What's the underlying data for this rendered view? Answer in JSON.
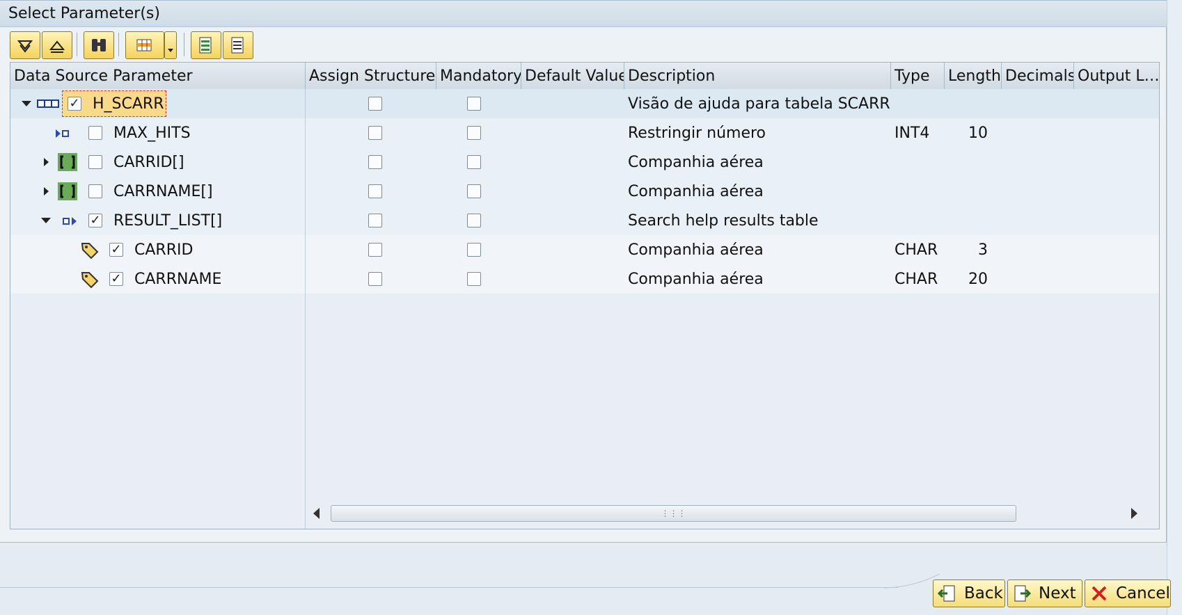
{
  "window": {
    "title": "Select Parameter(s)"
  },
  "toolbar": {
    "buttons": [
      "expand-all-icon",
      "collapse-all-icon",
      "find-icon",
      "layout-icon",
      "select-all-icon",
      "deselect-all-icon"
    ]
  },
  "grid": {
    "columns": [
      "Data Source Parameter",
      "Assign Structure",
      "Mandatory",
      "Default Value",
      "Description",
      "Type",
      "Length",
      "Decimals",
      "Output L…"
    ],
    "rows": [
      {
        "name": "H_SCARR",
        "checked": true,
        "description": "Visão de ajuda para tabela SCARR",
        "type": "",
        "length": ""
      },
      {
        "name": "MAX_HITS",
        "checked": false,
        "description": "Restringir número",
        "type": "INT4",
        "length": "10"
      },
      {
        "name": "CARRID[]",
        "checked": false,
        "description": "Companhia aérea",
        "type": "",
        "length": ""
      },
      {
        "name": "CARRNAME[]",
        "checked": false,
        "description": "Companhia aérea",
        "type": "",
        "length": ""
      },
      {
        "name": "RESULT_LIST[]",
        "checked": true,
        "description": "Search help results table",
        "type": "",
        "length": ""
      },
      {
        "name": "CARRID",
        "checked": true,
        "description": "Companhia aérea",
        "type": "CHAR",
        "length": "3"
      },
      {
        "name": "CARRNAME",
        "checked": true,
        "description": "Companhia aérea",
        "type": "CHAR",
        "length": "20"
      }
    ]
  },
  "footer": {
    "back_label": "Back",
    "next_label": "Next",
    "cancel_label": "Cancel"
  },
  "colors": {
    "accent": "#f5d35c",
    "selected_row": "#fbd98a"
  }
}
